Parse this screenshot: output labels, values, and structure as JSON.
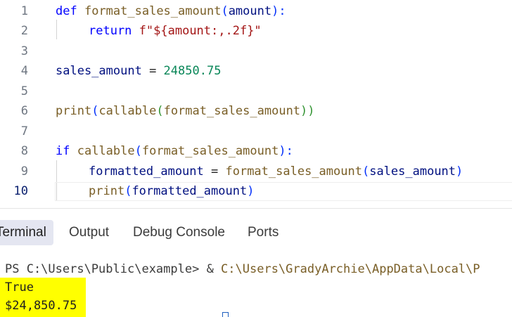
{
  "editor": {
    "active_line": "10",
    "lines": [
      {
        "n": "1",
        "t": [
          "def",
          " ",
          "format_sales_amount",
          "(",
          "amount",
          "):"
        ]
      },
      {
        "n": "2",
        "t": [
          "return",
          " ",
          "f\"${amount:,.2f}\""
        ]
      },
      {
        "n": "3"
      },
      {
        "n": "4",
        "t": [
          "sales_amount",
          " = ",
          "24850.75"
        ]
      },
      {
        "n": "5"
      },
      {
        "n": "6",
        "t": [
          "print",
          "(",
          "callable",
          "(",
          "format_sales_amount",
          "))"
        ]
      },
      {
        "n": "7"
      },
      {
        "n": "8",
        "t": [
          "if",
          " ",
          "callable",
          "(",
          "format_sales_amount",
          "):"
        ]
      },
      {
        "n": "9",
        "t": [
          "formatted_amount",
          " = ",
          "format_sales_amount",
          "(",
          "sales_amount",
          ")"
        ]
      },
      {
        "n": "10",
        "t": [
          "print",
          "(",
          "formatted_amount",
          ")"
        ]
      }
    ]
  },
  "panel": {
    "tabs": [
      "Terminal",
      "Output",
      "Debug Console",
      "Ports"
    ],
    "active_tab": "Terminal"
  },
  "terminal": {
    "prompt": "PS C:\\Users\\Public\\example> & ",
    "command_path": "C:\\Users\\GradyArchie\\AppData\\Local\\P",
    "output": [
      "True",
      "$24,850.75"
    ]
  },
  "colors": {
    "highlight": "#ffff00",
    "keyword": "#0000ff",
    "function": "#795e26",
    "variable": "#001080",
    "number": "#098658"
  }
}
